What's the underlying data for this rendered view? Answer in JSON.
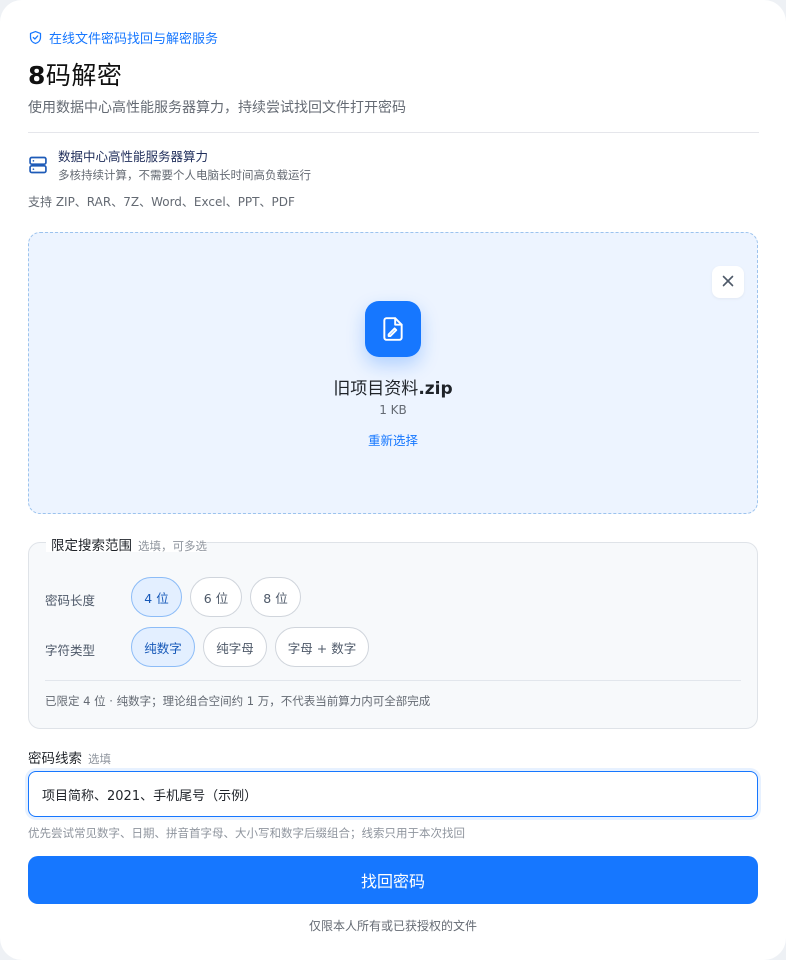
{
  "header": {
    "eyebrow": "在线文件密码找回与解密服务",
    "title_strong": "8",
    "title_rest": "码解密",
    "subtitle": "使用数据中心高性能服务器算力，持续尝试找回文件打开密码"
  },
  "feature": {
    "icon": "server-icon",
    "title": "数据中心高性能服务器算力",
    "subtitle": "多核持续计算，不需要个人电脑长时间高负载运行"
  },
  "formats": "支持 ZIP、RAR、7Z、Word、Excel、PPT、PDF",
  "upload": {
    "file_icon": "file-edit-icon",
    "file_name_base": "旧项目资料",
    "file_name_ext": ".zip",
    "file_size": "1 KB",
    "reselect_label": "重新选择",
    "close_icon": "close-icon"
  },
  "search_range": {
    "legend": "限定搜索范围",
    "legend_hint": "选填，可多选",
    "length_label": "密码长度",
    "length_options": [
      "4 位",
      "6 位",
      "8 位"
    ],
    "length_selected": "4 位",
    "charset_label": "字符类型",
    "charset_options": [
      "纯数字",
      "纯字母",
      "字母 + 数字"
    ],
    "charset_selected": "纯数字",
    "summary": "已限定 4 位 · 纯数字；理论组合空间约 1 万，不代表当前算力内可全部完成"
  },
  "clue": {
    "label": "密码线索",
    "hint": "选填",
    "value": "项目简称、2021、手机尾号（示例）",
    "help": "优先尝试常见数字、日期、拼音首字母、大小写和数字后缀组合；线索只用于本次找回"
  },
  "submit_label": "找回密码",
  "footnote": "仅限本人所有或已获授权的文件",
  "colors": {
    "accent": "#1677ff",
    "dropzone_bg": "#edf4ff",
    "chip_active_bg": "#e3efff"
  }
}
